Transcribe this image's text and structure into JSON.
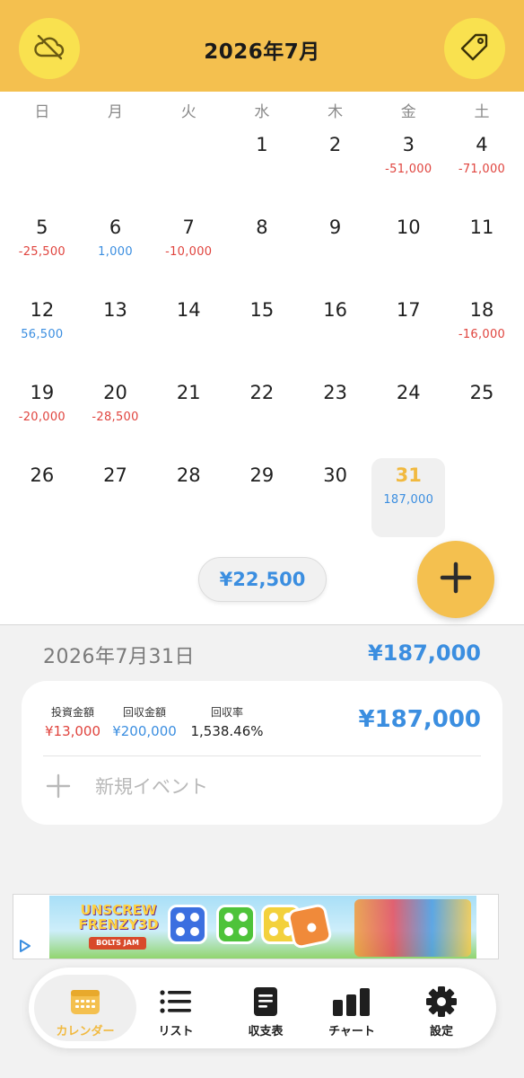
{
  "header": {
    "title": "2026年7月",
    "left_icon": "cloud-off-icon",
    "right_icon": "tag-icon"
  },
  "calendar": {
    "weekdays": [
      "日",
      "月",
      "火",
      "水",
      "木",
      "金",
      "土"
    ],
    "weeks": [
      [
        {
          "day": "",
          "amount": ""
        },
        {
          "day": "",
          "amount": ""
        },
        {
          "day": "",
          "amount": ""
        },
        {
          "day": "1",
          "amount": ""
        },
        {
          "day": "2",
          "amount": ""
        },
        {
          "day": "3",
          "amount": "-51,000",
          "kind": "neg"
        },
        {
          "day": "4",
          "amount": "-71,000",
          "kind": "neg"
        }
      ],
      [
        {
          "day": "5",
          "amount": "-25,500",
          "kind": "neg"
        },
        {
          "day": "6",
          "amount": "1,000",
          "kind": "pos"
        },
        {
          "day": "7",
          "amount": "-10,000",
          "kind": "neg"
        },
        {
          "day": "8",
          "amount": ""
        },
        {
          "day": "9",
          "amount": ""
        },
        {
          "day": "10",
          "amount": ""
        },
        {
          "day": "11",
          "amount": ""
        }
      ],
      [
        {
          "day": "12",
          "amount": "56,500",
          "kind": "pos"
        },
        {
          "day": "13",
          "amount": ""
        },
        {
          "day": "14",
          "amount": ""
        },
        {
          "day": "15",
          "amount": ""
        },
        {
          "day": "16",
          "amount": ""
        },
        {
          "day": "17",
          "amount": ""
        },
        {
          "day": "18",
          "amount": "-16,000",
          "kind": "neg"
        }
      ],
      [
        {
          "day": "19",
          "amount": "-20,000",
          "kind": "neg"
        },
        {
          "day": "20",
          "amount": "-28,500",
          "kind": "neg"
        },
        {
          "day": "21",
          "amount": ""
        },
        {
          "day": "22",
          "amount": ""
        },
        {
          "day": "23",
          "amount": ""
        },
        {
          "day": "24",
          "amount": ""
        },
        {
          "day": "25",
          "amount": ""
        }
      ],
      [
        {
          "day": "26",
          "amount": ""
        },
        {
          "day": "27",
          "amount": ""
        },
        {
          "day": "28",
          "amount": ""
        },
        {
          "day": "29",
          "amount": ""
        },
        {
          "day": "30",
          "amount": ""
        },
        {
          "day": "31",
          "amount": "187,000",
          "kind": "pos",
          "today": true
        },
        {
          "day": "",
          "amount": ""
        }
      ]
    ],
    "month_total": "¥22,500"
  },
  "selected": {
    "date": "2026年7月31日",
    "amount": "¥187,000",
    "card": {
      "invest_label": "投資金額",
      "invest_value": "¥13,000",
      "return_label": "回収金額",
      "return_value": "¥200,000",
      "rate_label": "回収率",
      "rate_value": "1,538.46%",
      "total": "¥187,000",
      "new_event": "新規イベント"
    }
  },
  "ad": {
    "title": "UNSCREW FRENZY3D",
    "subtitle": "BOLTS JAM"
  },
  "tabs": [
    {
      "label": "カレンダー",
      "icon": "calendar-icon",
      "active": true
    },
    {
      "label": "リスト",
      "icon": "list-icon"
    },
    {
      "label": "収支表",
      "icon": "document-icon"
    },
    {
      "label": "チャート",
      "icon": "bar-chart-icon"
    },
    {
      "label": "設定",
      "icon": "gear-icon"
    }
  ],
  "colors": {
    "accent": "#f4c04f",
    "negative": "#e0443e",
    "positive": "#3b8ee0"
  }
}
